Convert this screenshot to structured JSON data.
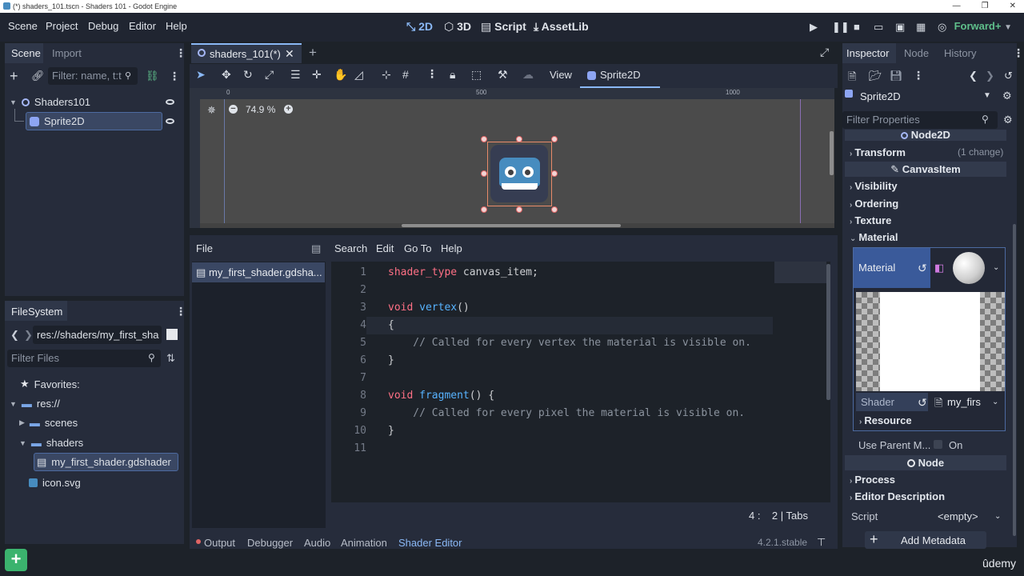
{
  "window": {
    "title": "(*) shaders_101.tscn - Shaders 101 - Godot Engine",
    "controls": [
      "—",
      "❐",
      "✕"
    ]
  },
  "menu": [
    "Scene",
    "Project",
    "Debug",
    "Editor",
    "Help"
  ],
  "workspaces": [
    {
      "label": "2D",
      "icon": "2d-icon"
    },
    {
      "label": "3D",
      "icon": "3d-icon"
    },
    {
      "label": "Script",
      "icon": "script-icon"
    },
    {
      "label": "AssetLib",
      "icon": "assetlib-icon"
    }
  ],
  "renderer": "Forward+",
  "scene_dock": {
    "tabs": [
      "Scene",
      "Import"
    ],
    "filter_placeholder": "Filter: name, t:t",
    "tree": [
      {
        "label": "Shaders101"
      },
      {
        "label": "Sprite2D"
      }
    ]
  },
  "filesystem_dock": {
    "tab": "FileSystem",
    "path": "res://shaders/my_first_sha",
    "filter_placeholder": "Filter Files",
    "favorites": "Favorites:",
    "items": [
      {
        "label": "res://"
      },
      {
        "label": "scenes"
      },
      {
        "label": "shaders"
      },
      {
        "label": "my_first_shader.gdshader"
      },
      {
        "label": "icon.svg"
      }
    ]
  },
  "scene_tab": {
    "label": "shaders_101(*)"
  },
  "toolbar": {
    "view": "View",
    "node": "Sprite2D"
  },
  "viewport": {
    "zoom": "74.9 %",
    "ruler_marks": [
      "0",
      "500",
      "1000"
    ]
  },
  "shader_editor": {
    "menus": [
      "File",
      "Search",
      "Edit",
      "Go To",
      "Help"
    ],
    "file": "my_first_shader.gdsha...",
    "lines": [
      {
        "n": "1",
        "parts": [
          [
            "kw",
            "shader_type"
          ],
          [
            "txt",
            " canvas_item;"
          ]
        ]
      },
      {
        "n": "2",
        "parts": []
      },
      {
        "n": "3",
        "parts": [
          [
            "kw",
            "void"
          ],
          [
            "txt",
            " "
          ],
          [
            "fn",
            "vertex"
          ],
          [
            "txt",
            "()"
          ]
        ]
      },
      {
        "n": "4",
        "parts": [
          [
            "txt",
            "{"
          ]
        ]
      },
      {
        "n": "5",
        "parts": [
          [
            "cm",
            "    // Called for every vertex the material is visible on."
          ]
        ]
      },
      {
        "n": "6",
        "parts": [
          [
            "txt",
            "}"
          ]
        ]
      },
      {
        "n": "7",
        "parts": []
      },
      {
        "n": "8",
        "parts": [
          [
            "kw",
            "void"
          ],
          [
            "txt",
            " "
          ],
          [
            "fn",
            "fragment"
          ],
          [
            "txt",
            "() {"
          ]
        ]
      },
      {
        "n": "9",
        "parts": [
          [
            "cm",
            "    // Called for every pixel the material is visible on."
          ]
        ]
      },
      {
        "n": "10",
        "parts": [
          [
            "txt",
            "}"
          ]
        ]
      },
      {
        "n": "11",
        "parts": []
      }
    ],
    "status": {
      "line": "4",
      "col": "2",
      "indent": "Tabs"
    }
  },
  "bottom_panel": {
    "tabs": [
      "Output",
      "Debugger",
      "Audio",
      "Animation",
      "Shader Editor"
    ],
    "version": "4.2.1.stable"
  },
  "inspector": {
    "tabs": [
      "Inspector",
      "Node",
      "History"
    ],
    "object": "Sprite2D",
    "filter_placeholder": "Filter Properties",
    "node2d": "Node2D",
    "transform": "Transform",
    "transform_note": "(1 change)",
    "canvasitem": "CanvasItem",
    "sections": [
      "Visibility",
      "Ordering",
      "Texture",
      "Material"
    ],
    "material_label": "Material",
    "shader_label": "Shader",
    "shader_value": "my_firs",
    "resource": "Resource",
    "use_parent": "Use Parent M...",
    "use_parent_value": "On",
    "node_section": "Node",
    "process": "Process",
    "editor_description": "Editor Description",
    "script_label": "Script",
    "script_value": "<empty>",
    "add_metadata": "Add Metadata"
  },
  "watermark": "ûdemy",
  "colors": {
    "accent": "#8ab8f5",
    "bg": "#1d2229",
    "panel": "#262c3b",
    "selection": "#3a4763"
  }
}
